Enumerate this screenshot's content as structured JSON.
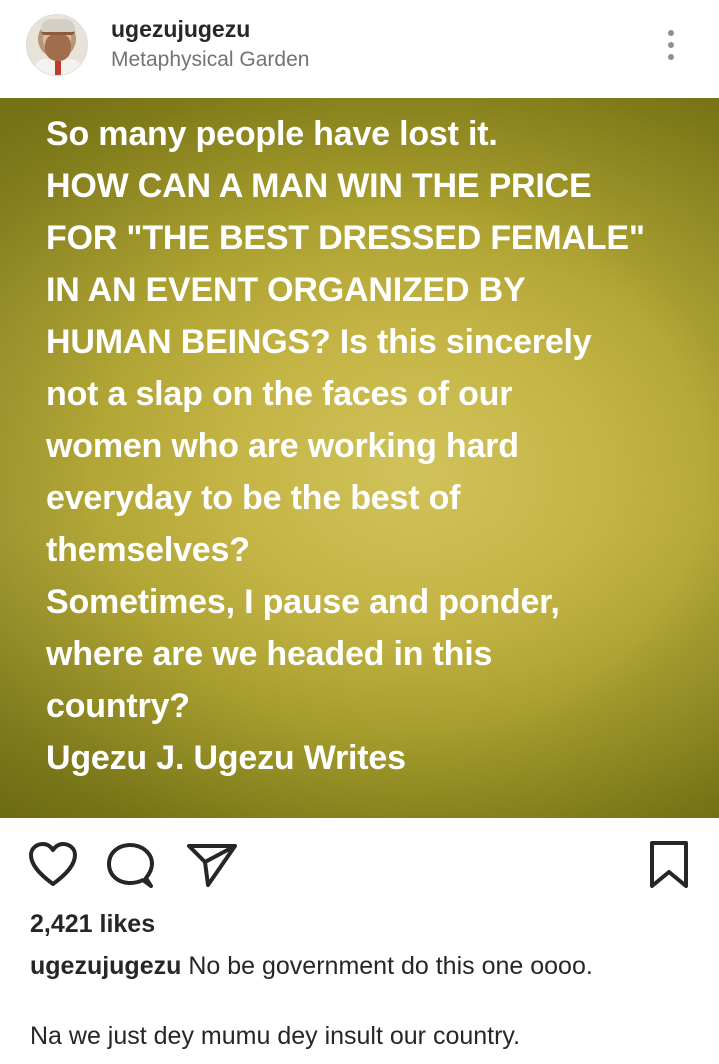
{
  "post": {
    "username": "ugezujugezu",
    "location": "Metaphysical Garden",
    "image_text": "So many people have lost it.\nHOW CAN A MAN WIN THE PRICE\nFOR \"THE BEST DRESSED FEMALE\"\nIN AN EVENT ORGANIZED BY\nHUMAN BEINGS? Is this sincerely\nnot a slap on the faces of our\nwomen who are working hard\neveryday to be the best of\nthemselves?\nSometimes, I pause and ponder,\nwhere are we headed in this\ncountry?\nUgezu J. Ugezu Writes",
    "likes": "2,421 likes",
    "caption_username": "ugezujugezu",
    "caption_text": "No be government do this one oooo.",
    "caption_line_2": "Na we just dey mumu dey insult our country."
  },
  "icons": {
    "menu": "more-vertical-icon",
    "like": "heart-icon",
    "comment": "comment-icon",
    "share": "send-icon",
    "save": "bookmark-icon"
  },
  "colors": {
    "image_background": "#b5a93b",
    "image_text": "#ffffff",
    "secondary_text": "#737373"
  }
}
